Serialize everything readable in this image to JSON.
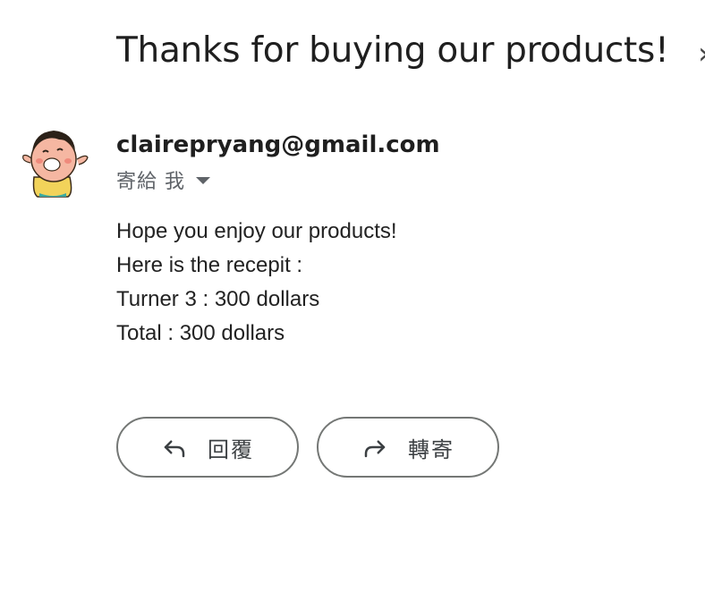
{
  "email": {
    "subject": "Thanks for buying our products!",
    "subject_trailing_glyph": "›",
    "sender": "clairepryang@gmail.com",
    "recipient_label": "寄給 我",
    "body_lines": [
      "Hope you enjoy our products!",
      "Here is the recepit :",
      "Turner 3 : 300 dollars",
      "Total : 300 dollars"
    ]
  },
  "actions": {
    "reply_label": "回覆",
    "forward_label": "轉寄"
  },
  "icons": {
    "avatar": "cartoon-avatar",
    "recipient_toggle": "caret-down-icon",
    "reply": "reply-arrow-icon",
    "forward": "forward-arrow-icon"
  },
  "colors": {
    "text_primary": "#1f1f1f",
    "text_secondary": "#5f6368",
    "button_border": "#747775"
  }
}
